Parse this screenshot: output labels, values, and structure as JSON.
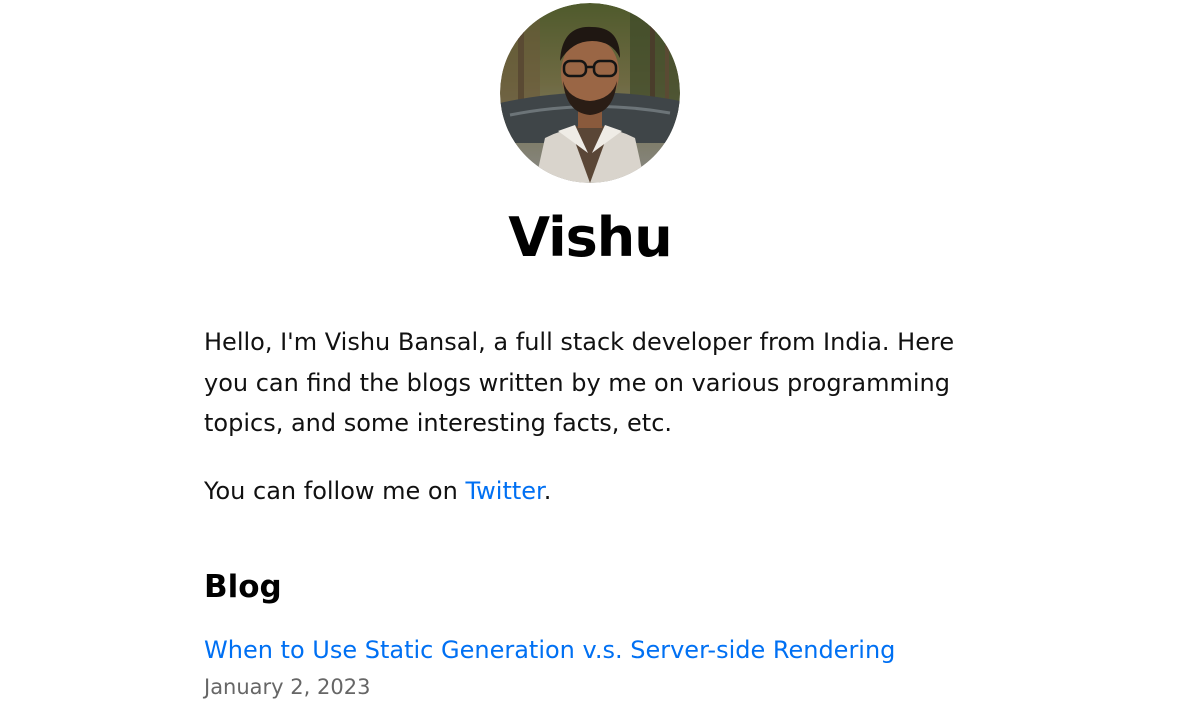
{
  "profile": {
    "name": "Vishu",
    "avatar_alt": "Vishu profile photo"
  },
  "intro": {
    "paragraph": "Hello, I'm Vishu Bansal, a full stack developer from India. Here you can find the blogs written by me on various programming topics, and some interesting facts, etc.",
    "follow_prefix": "You can follow me on ",
    "follow_link": "Twitter",
    "follow_suffix": "."
  },
  "blog": {
    "heading": "Blog",
    "posts": [
      {
        "title": "When to Use Static Generation v.s. Server-side Rendering",
        "date": "January 2, 2023"
      }
    ]
  },
  "colors": {
    "link": "#0070f3",
    "date": "#666666",
    "text": "#111111"
  }
}
